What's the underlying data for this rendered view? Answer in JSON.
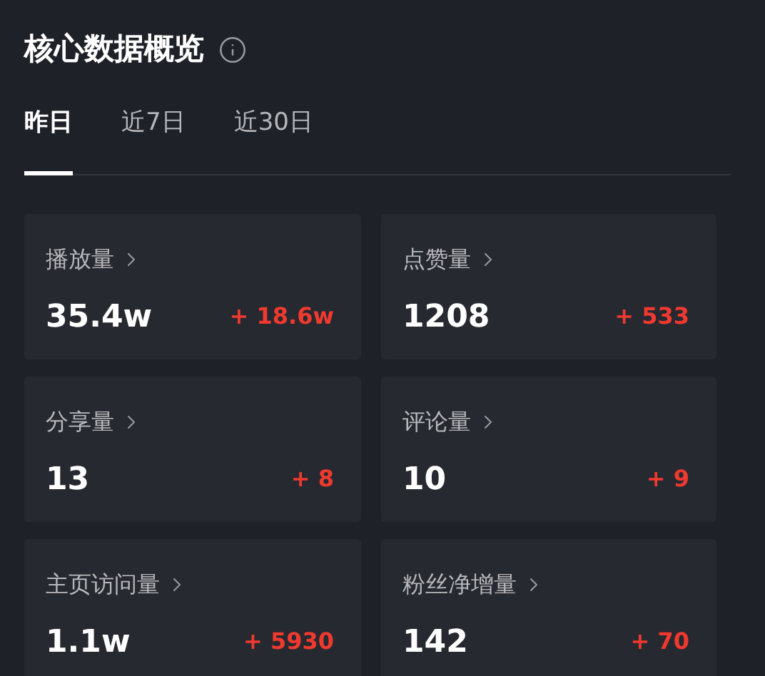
{
  "title": "核心数据概览",
  "tabs": [
    {
      "label": "昨日",
      "selected": true
    },
    {
      "label": "近7日",
      "selected": false
    },
    {
      "label": "近30日",
      "selected": false
    }
  ],
  "metrics": [
    {
      "label": "播放量",
      "value": "35.4w",
      "change": "+ 18.6w"
    },
    {
      "label": "点赞量",
      "value": "1208",
      "change": "+ 533"
    },
    {
      "label": "分享量",
      "value": "13",
      "change": "+ 8"
    },
    {
      "label": "评论量",
      "value": "10",
      "change": "+ 9"
    },
    {
      "label": "主页访问量",
      "value": "1.1w",
      "change": "+ 5930"
    },
    {
      "label": "粉丝净增量",
      "value": "142",
      "change": "+ 70"
    }
  ]
}
